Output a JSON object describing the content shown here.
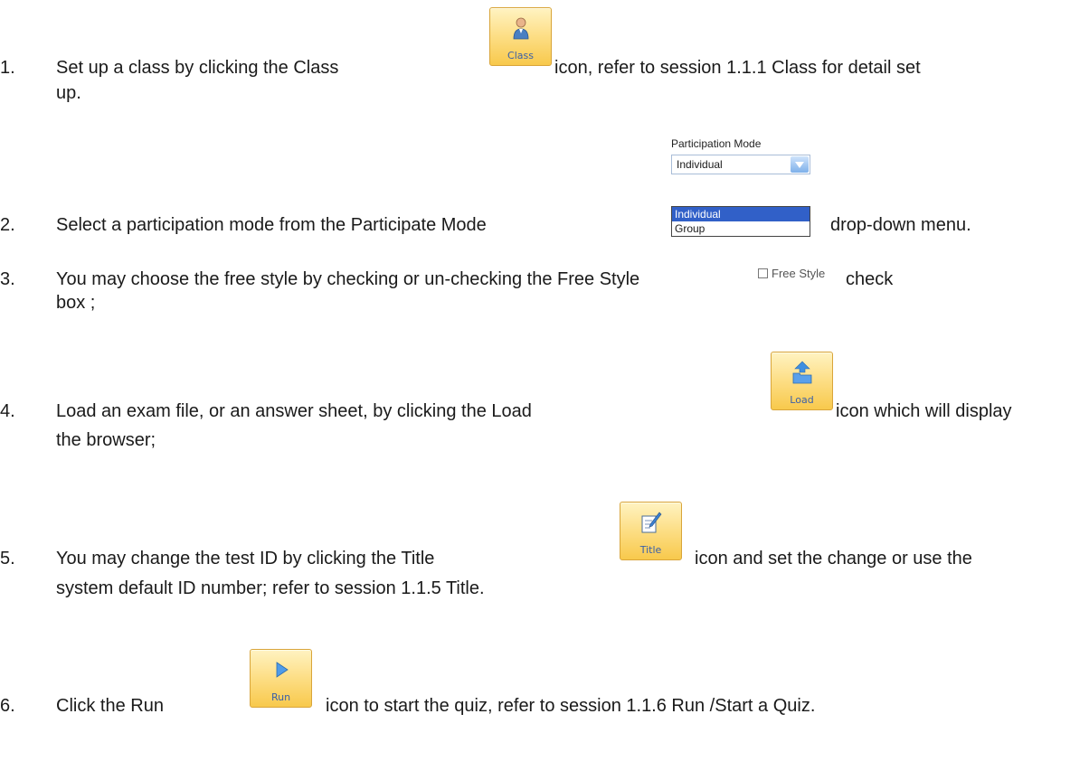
{
  "items": [
    {
      "num": "1.",
      "before": "Set up a class by clicking the Class",
      "after": "icon, refer to session 1.1.1 Class for detail set",
      "cont": "up."
    },
    {
      "num": "2.",
      "before": "Select a participation mode from the Participate Mode",
      "after": "drop-down menu."
    },
    {
      "num": "3.",
      "before": "You may choose the free style by checking or un-checking the Free Style",
      "after": "check",
      "cont": "box ;"
    },
    {
      "num": "4.",
      "before": "Load an exam file, or an answer sheet, by clicking the Load",
      "after": "icon which will display",
      "cont": "the browser;"
    },
    {
      "num": "5.",
      "before": "You may change the test ID by clicking the Title",
      "after": "icon and set the change or use the",
      "cont": "system default ID number; refer to session 1.1.5 Title."
    },
    {
      "num": "6.",
      "before": "Click the Run",
      "after": "icon to start the quiz, refer to session 1.1.6 Run /Start a Quiz."
    }
  ],
  "buttons": {
    "class_label": "Class",
    "load_label": "Load",
    "title_label": "Title",
    "run_label": "Run",
    "class_icon": "teacher-person-icon",
    "load_icon": "folder-upload-icon",
    "title_icon": "pencil-edit-icon",
    "run_icon": "play-triangle-icon"
  },
  "participation": {
    "label": "Participation Mode",
    "selected": "Individual",
    "options": [
      "Individual",
      "Group"
    ]
  },
  "free_style": {
    "label": "Free Style",
    "checked": false
  },
  "colors": {
    "button_bg": "#fde08a",
    "button_border": "#d9a53a",
    "button_label": "#3a5fa8",
    "selected_option": "#3160c8"
  }
}
